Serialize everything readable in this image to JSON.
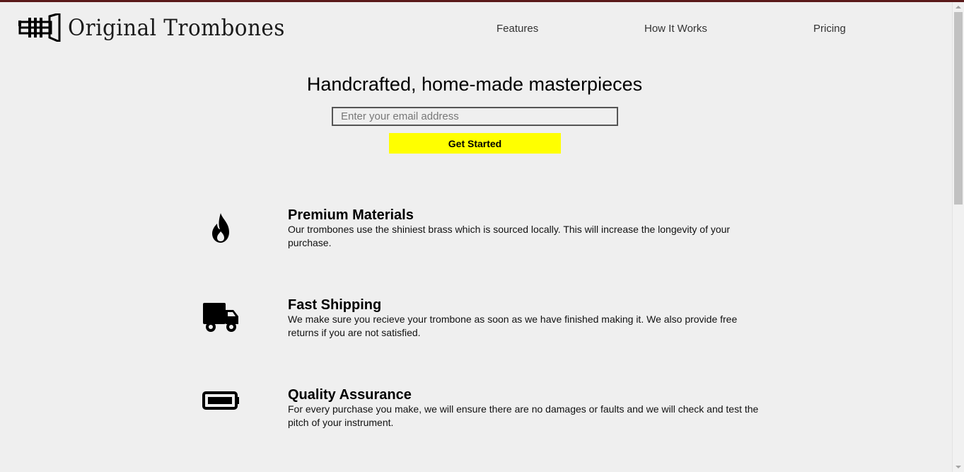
{
  "header": {
    "logo_text": "Original Trombones",
    "logo_icon": "trumpet-logo-icon",
    "nav": [
      {
        "label": "Features"
      },
      {
        "label": "How It Works"
      },
      {
        "label": "Pricing"
      }
    ]
  },
  "hero": {
    "title": "Handcrafted, home-made masterpieces",
    "email_placeholder": "Enter your email address",
    "email_value": "",
    "cta_label": "Get Started",
    "cta_color": "#ffff00"
  },
  "features": [
    {
      "icon": "fire-icon",
      "title": "Premium Materials",
      "description": "Our trombones use the shiniest brass which is sourced locally. This will increase the longevity of your purchase."
    },
    {
      "icon": "truck-icon",
      "title": "Fast Shipping",
      "description": "We make sure you recieve your trombone as soon as we have finished making it. We also provide free returns if you are not satisfied."
    },
    {
      "icon": "battery-full-icon",
      "title": "Quality Assurance",
      "description": "For every purchase you make, we will ensure there are no damages or faults and we will check and test the pitch of your instrument."
    }
  ]
}
